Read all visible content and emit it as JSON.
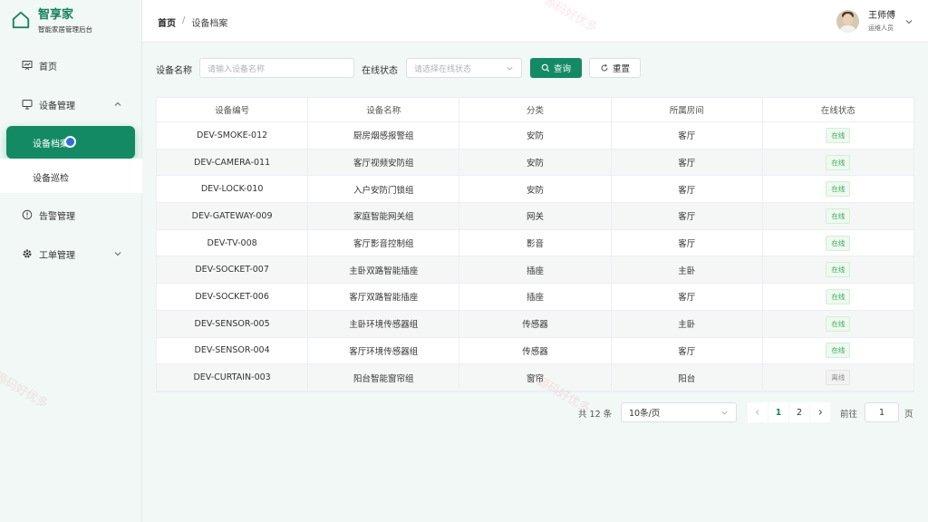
{
  "brand": {
    "title": "智享家",
    "subtitle": "智能家居管理后台"
  },
  "sidebar": {
    "items": [
      {
        "label": "首页",
        "icon": "chart-board-icon"
      },
      {
        "label": "设备管理",
        "icon": "monitor-icon",
        "expanded": true,
        "children": [
          {
            "label": "设备档案",
            "active": true
          },
          {
            "label": "设备巡检"
          }
        ]
      },
      {
        "label": "告警管理",
        "icon": "alert-circle-icon"
      },
      {
        "label": "工单管理",
        "icon": "gear-icon",
        "expanded": false
      }
    ]
  },
  "header": {
    "breadcrumb": {
      "home": "首页",
      "sep": "/",
      "current": "设备档案"
    },
    "user": {
      "name": "王师傅",
      "role": "运维人员"
    }
  },
  "filter": {
    "name_label": "设备名称",
    "name_placeholder": "请输入设备名称",
    "status_label": "在线状态",
    "status_placeholder": "请选择在线状态",
    "query_label": "查询",
    "reset_label": "重置"
  },
  "table": {
    "headers": [
      "设备编号",
      "设备名称",
      "分类",
      "所属房间",
      "在线状态"
    ],
    "rows": [
      {
        "id": "DEV-SMOKE-012",
        "name": "厨房烟感报警组",
        "category": "安防",
        "room": "客厅",
        "status": "在线",
        "online": true
      },
      {
        "id": "DEV-CAMERA-011",
        "name": "客厅视频安防组",
        "category": "安防",
        "room": "客厅",
        "status": "在线",
        "online": true
      },
      {
        "id": "DEV-LOCK-010",
        "name": "入户安防门锁组",
        "category": "安防",
        "room": "客厅",
        "status": "在线",
        "online": true
      },
      {
        "id": "DEV-GATEWAY-009",
        "name": "家庭智能网关组",
        "category": "网关",
        "room": "客厅",
        "status": "在线",
        "online": true
      },
      {
        "id": "DEV-TV-008",
        "name": "客厅影音控制组",
        "category": "影音",
        "room": "客厅",
        "status": "在线",
        "online": true
      },
      {
        "id": "DEV-SOCKET-007",
        "name": "主卧双路智能插座",
        "category": "插座",
        "room": "主卧",
        "status": "在线",
        "online": true
      },
      {
        "id": "DEV-SOCKET-006",
        "name": "客厅双路智能插座",
        "category": "插座",
        "room": "客厅",
        "status": "在线",
        "online": true
      },
      {
        "id": "DEV-SENSOR-005",
        "name": "主卧环境传感器组",
        "category": "传感器",
        "room": "主卧",
        "status": "在线",
        "online": true
      },
      {
        "id": "DEV-SENSOR-004",
        "name": "客厅环境传感器组",
        "category": "传感器",
        "room": "客厅",
        "status": "在线",
        "online": true
      },
      {
        "id": "DEV-CURTAIN-003",
        "name": "阳台智能窗帘组",
        "category": "窗帘",
        "room": "阳台",
        "status": "离线",
        "online": false
      }
    ]
  },
  "pagination": {
    "total": "共 12 条",
    "page_size": "10条/页",
    "pages": [
      "1",
      "2"
    ],
    "current_page": "1",
    "goto_label": "前往",
    "goto_value": "1",
    "goto_suffix": "页"
  },
  "watermark": "源码好优多",
  "colors": {
    "primary": "#138a64",
    "online": "#3ba55c",
    "offline": "#8a8a8a"
  }
}
